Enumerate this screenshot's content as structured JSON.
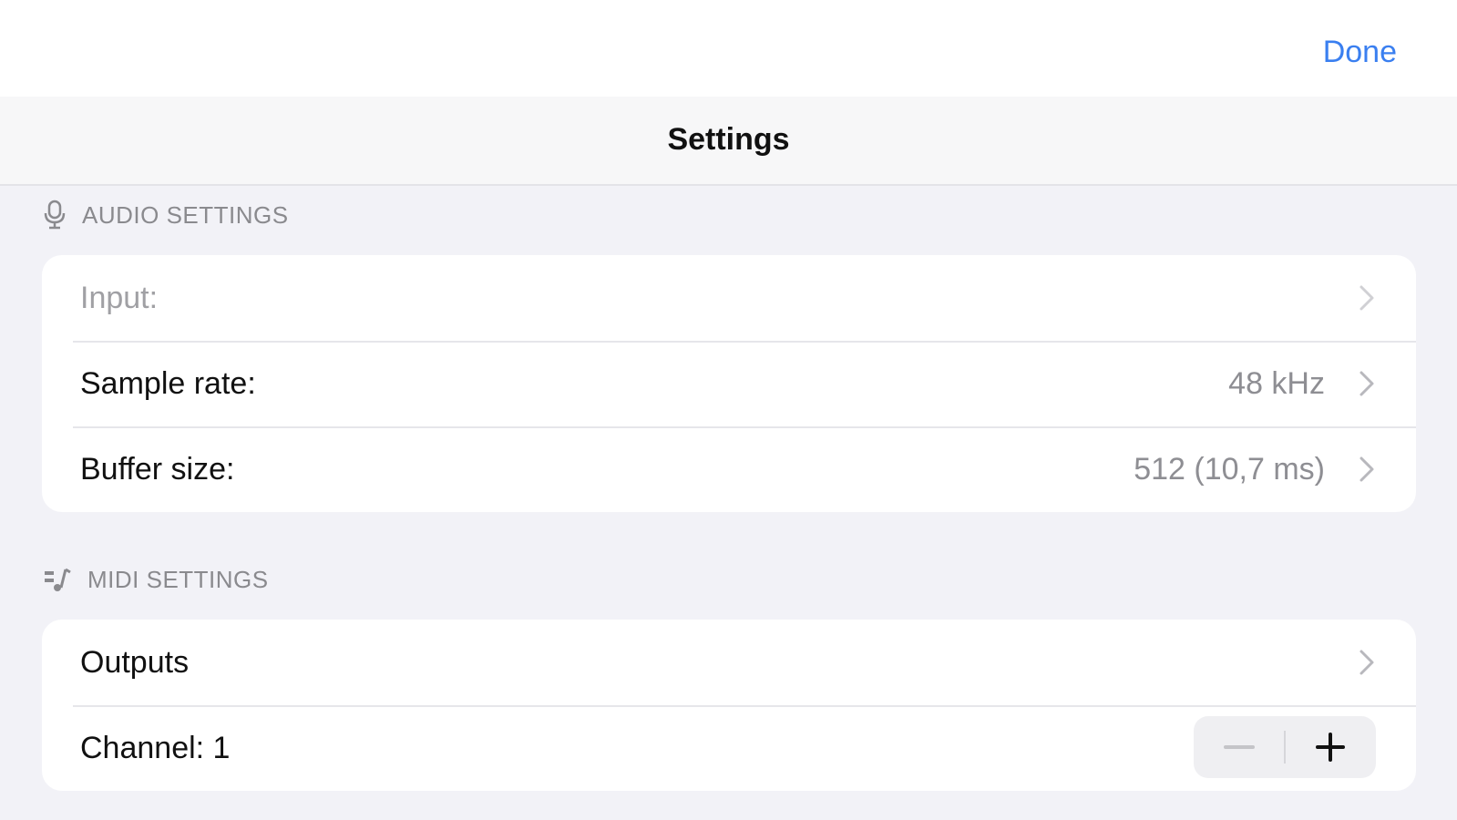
{
  "header": {
    "done_label": "Done",
    "title": "Settings"
  },
  "audio_section": {
    "header": "AUDIO SETTINGS",
    "icon": "microphone-icon",
    "rows": [
      {
        "label": "Input:",
        "value": "",
        "enabled": false
      },
      {
        "label": "Sample rate:",
        "value": "48 kHz",
        "enabled": true
      },
      {
        "label": "Buffer size:",
        "value": "512 (10,7 ms)",
        "enabled": true
      }
    ]
  },
  "midi_section": {
    "header": "MIDI SETTINGS",
    "icon": "midi-icon",
    "rows": [
      {
        "label": "Outputs",
        "value": ""
      },
      {
        "label": "Channel: 1",
        "stepper": {
          "minus_enabled": false,
          "plus_enabled": true
        }
      }
    ]
  },
  "colors": {
    "accent": "#3a7ff0",
    "background": "#f2f2f7",
    "secondary_text": "#8e8e93"
  }
}
